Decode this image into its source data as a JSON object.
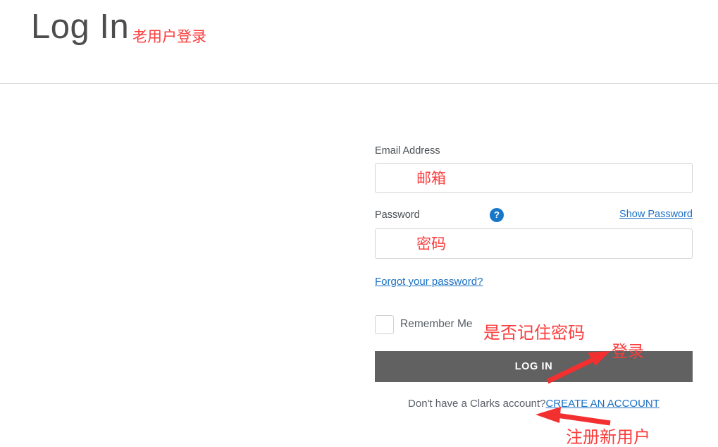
{
  "header": {
    "title": "Log In",
    "title_annotation": "老用户登录"
  },
  "form": {
    "email": {
      "label": "Email Address",
      "value": "",
      "placeholder": "邮箱"
    },
    "password": {
      "label": "Password",
      "help_icon": "?",
      "show_password_label": "Show Password",
      "value": "",
      "placeholder": "密码"
    },
    "forgot_password_label": "Forgot your password?",
    "remember": {
      "label": "Remember Me",
      "checked": false,
      "annotation": "是否记住密码"
    },
    "submit": {
      "label": "LOG IN",
      "annotation": "登录",
      "background": "#616161",
      "text_color": "#ffffff"
    },
    "create_account": {
      "prompt": "Don't have a Clarks account?",
      "link_label": "CREATE AN ACCOUNT",
      "annotation": "注册新用户"
    }
  },
  "colors": {
    "annotation_red": "#fb3c3c",
    "link_blue": "#1a6fc4",
    "help_blue": "#1878c8",
    "button_gray": "#616161",
    "divider_gray": "#dcdcdc"
  }
}
